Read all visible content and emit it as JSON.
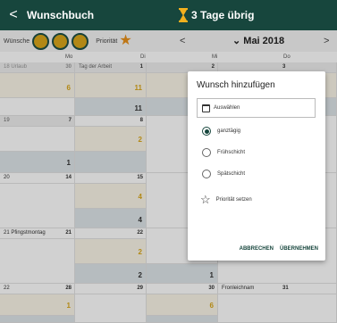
{
  "appbar": {
    "back": "<",
    "title": "Wunschbuch",
    "days_left": "3 Tage übrig"
  },
  "toolbar": {
    "wishes_label": "Wünsche",
    "priority_label": "Priorität",
    "prev": "<",
    "month": "Mai 2018",
    "next": ">"
  },
  "weekdays": [
    "Mo",
    "Di",
    "Mi",
    "Do"
  ],
  "weeks": [
    {
      "mo": {
        "holiday": "18 Urlaub",
        "day": "30",
        "val": "6"
      },
      "di": {
        "holiday": "Tag der Arbeit",
        "day": "1",
        "val1": "11",
        "val2": "11"
      },
      "mi": {
        "day": "2"
      },
      "do": {
        "day": "3"
      }
    },
    {
      "mo": {
        "holiday": "19",
        "day": "7",
        "val": "1"
      },
      "di": {
        "day": "8",
        "val": "2"
      }
    },
    {
      "mo": {
        "holiday": "20",
        "day": "14"
      },
      "di": {
        "day": "15",
        "val1": "4",
        "val2": "4"
      }
    },
    {
      "mo": {
        "holiday": "21 Pfingstmontag",
        "day": "21"
      },
      "di": {
        "day": "22",
        "val1": "2",
        "val2": "2"
      },
      "mi": {
        "val": "1"
      }
    },
    {
      "mo": {
        "holiday": "22",
        "day": "28",
        "val": "1"
      },
      "di": {
        "day": "29"
      },
      "mi": {
        "day": "30",
        "val": "6"
      },
      "do": {
        "holiday": "Fronleichnam",
        "day": "31"
      }
    }
  ],
  "dialog": {
    "title": "Wunsch hinzufügen",
    "select": "Auswählen",
    "options": [
      "ganztägig",
      "Frühschicht",
      "Spätschicht"
    ],
    "priority": "Priorität setzen",
    "cancel": "ABBRECHEN",
    "accept": "ÜBERNEHMEN"
  },
  "colors": {
    "primary": "#17463d",
    "wish_gold": "#d9a71a",
    "star": "#e8901a"
  }
}
